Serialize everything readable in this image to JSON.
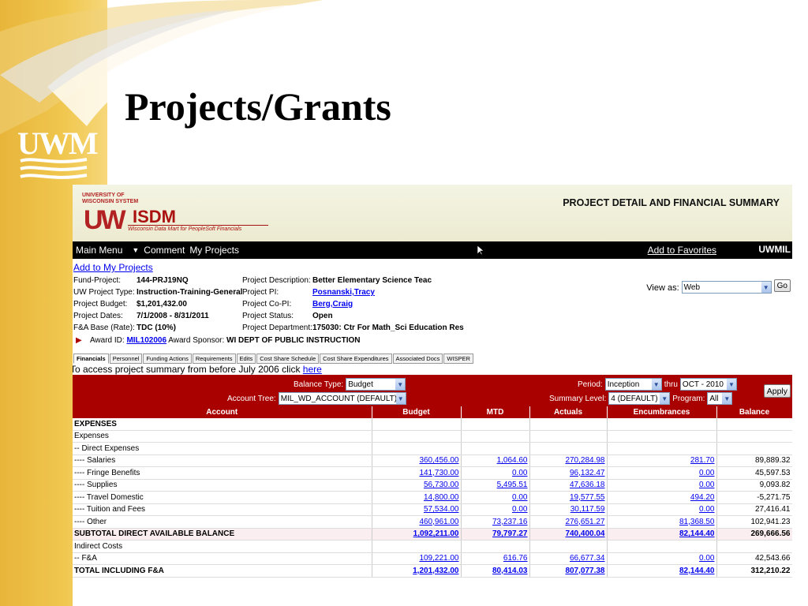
{
  "slide": {
    "title": "Projects/Grants",
    "logo_text": "UWM"
  },
  "banner": {
    "university": [
      "UNIVERSITY OF",
      "WISCONSIN SYSTEM"
    ],
    "brand_uw": "UW",
    "brand_isdm": "ISDM",
    "tagline": "Wisconsin Data Mart for PeopleSoft Financials",
    "page_title": "PROJECT DETAIL AND FINANCIAL SUMMARY"
  },
  "nav": {
    "main_menu": "Main Menu",
    "comment": "Comment",
    "my_projects": "My Projects",
    "add_favorites": "Add to Favorites",
    "user": "UWMIL"
  },
  "add_to_my_projects": "Add to My Projects",
  "project": {
    "fund_project_label": "Fund-Project:",
    "fund_project": "144-PRJ19NQ",
    "type_label": "UW Project Type:",
    "type": "Instruction-Training-General",
    "budget_label": "Project Budget:",
    "budget": "$1,201,432.00",
    "dates_label": "Project Dates:",
    "dates": "7/1/2008 - 8/31/2011",
    "fa_label": "F&A Base (Rate):",
    "fa": "TDC (10%)",
    "desc_label": "Project Description:",
    "desc": "Better Elementary Science Teac",
    "pi_label": "Project PI:",
    "pi": "Posnanski,Tracy",
    "copi_label": "Project Co-PI:",
    "copi": "Berg,Craig",
    "status_label": "Project Status:",
    "status": "Open",
    "dept_label": "Project Department:",
    "dept": "175030: Ctr For Math_Sci Education Res"
  },
  "view_as": {
    "label": "View as:",
    "value": "Web",
    "go": "Go"
  },
  "award": {
    "id_label": "Award ID:",
    "id": "MIL102006",
    "sponsor_label": "Award Sponsor:",
    "sponsor": "WI DEPT OF PUBLIC INSTRUCTION"
  },
  "tabs": [
    "Financials",
    "Personnel",
    "Funding Actions",
    "Requirements",
    "Edits",
    "Cost Share Schedule",
    "Cost Share Expenditures",
    "Associated Docs",
    "WISPER"
  ],
  "prev_note": {
    "text": "To access project summary from before July 2006 click ",
    "link": "here"
  },
  "filters": {
    "balance_type_label": "Balance Type:",
    "balance_type": "Budget",
    "account_tree_label": "Account Tree:",
    "account_tree": "MIL_WD_ACCOUNT (DEFAULT)",
    "period_label": "Period:",
    "period_from": "Inception",
    "thru_label": "thru",
    "period_to": "OCT - 2010",
    "summary_label": "Summary Level:",
    "summary": "4 (DEFAULT)",
    "program_label": "Program:",
    "program": "All",
    "apply": "Apply"
  },
  "table": {
    "headers": [
      "Account",
      "Budget",
      "MTD",
      "Actuals",
      "Encumbrances",
      "Balance"
    ],
    "rows": [
      {
        "account": "EXPENSES",
        "style": "bold",
        "budget": "",
        "mtd": "",
        "actuals": "",
        "enc": "",
        "balance": ""
      },
      {
        "account": "Expenses",
        "style": "",
        "budget": "",
        "mtd": "",
        "actuals": "",
        "enc": "",
        "balance": ""
      },
      {
        "account": "-- Direct Expenses",
        "style": "",
        "budget": "",
        "mtd": "",
        "actuals": "",
        "enc": "",
        "balance": ""
      },
      {
        "account": "---- Salaries",
        "style": "",
        "budget": "360,456.00",
        "mtd": "1,064.60",
        "actuals": "270,284.98",
        "enc": "281.70",
        "balance": "89,889.32"
      },
      {
        "account": "---- Fringe Benefits",
        "style": "",
        "budget": "141,730.00",
        "mtd": "0.00",
        "actuals": "96,132.47",
        "enc": "0.00",
        "balance": "45,597.53"
      },
      {
        "account": "---- Supplies",
        "style": "",
        "budget": "56,730.00",
        "mtd": "5,495.51",
        "actuals": "47,636.18",
        "enc": "0.00",
        "balance": "9,093.82"
      },
      {
        "account": "---- Travel Domestic",
        "style": "",
        "budget": "14,800.00",
        "mtd": "0.00",
        "actuals": "19,577.55",
        "enc": "494.20",
        "balance": "-5,271.75"
      },
      {
        "account": "---- Tuition and Fees",
        "style": "",
        "budget": "57,534.00",
        "mtd": "0.00",
        "actuals": "30,117.59",
        "enc": "0.00",
        "balance": "27,416.41"
      },
      {
        "account": "---- Other",
        "style": "",
        "budget": "460,961.00",
        "mtd": "73,237.16",
        "actuals": "276,651.27",
        "enc": "81,368.50",
        "balance": "102,941.23"
      },
      {
        "account": "SUBTOTAL DIRECT AVAILABLE BALANCE",
        "style": "sub",
        "budget": "1,092,211.00",
        "mtd": "79,797.27",
        "actuals": "740,400.04",
        "enc": "82,144.40",
        "balance": "269,666.56"
      },
      {
        "account": "Indirect Costs",
        "style": "",
        "budget": "",
        "mtd": "",
        "actuals": "",
        "enc": "",
        "balance": ""
      },
      {
        "account": "-- F&A",
        "style": "",
        "budget": "109,221.00",
        "mtd": "616.76",
        "actuals": "66,677.34",
        "enc": "0.00",
        "balance": "42,543.66"
      },
      {
        "account": "TOTAL INCLUDING F&A",
        "style": "bold",
        "budget": "1,201,432.00",
        "mtd": "80,414.03",
        "actuals": "807,077.38",
        "enc": "82,144.40",
        "balance": "312,210.22"
      }
    ]
  }
}
